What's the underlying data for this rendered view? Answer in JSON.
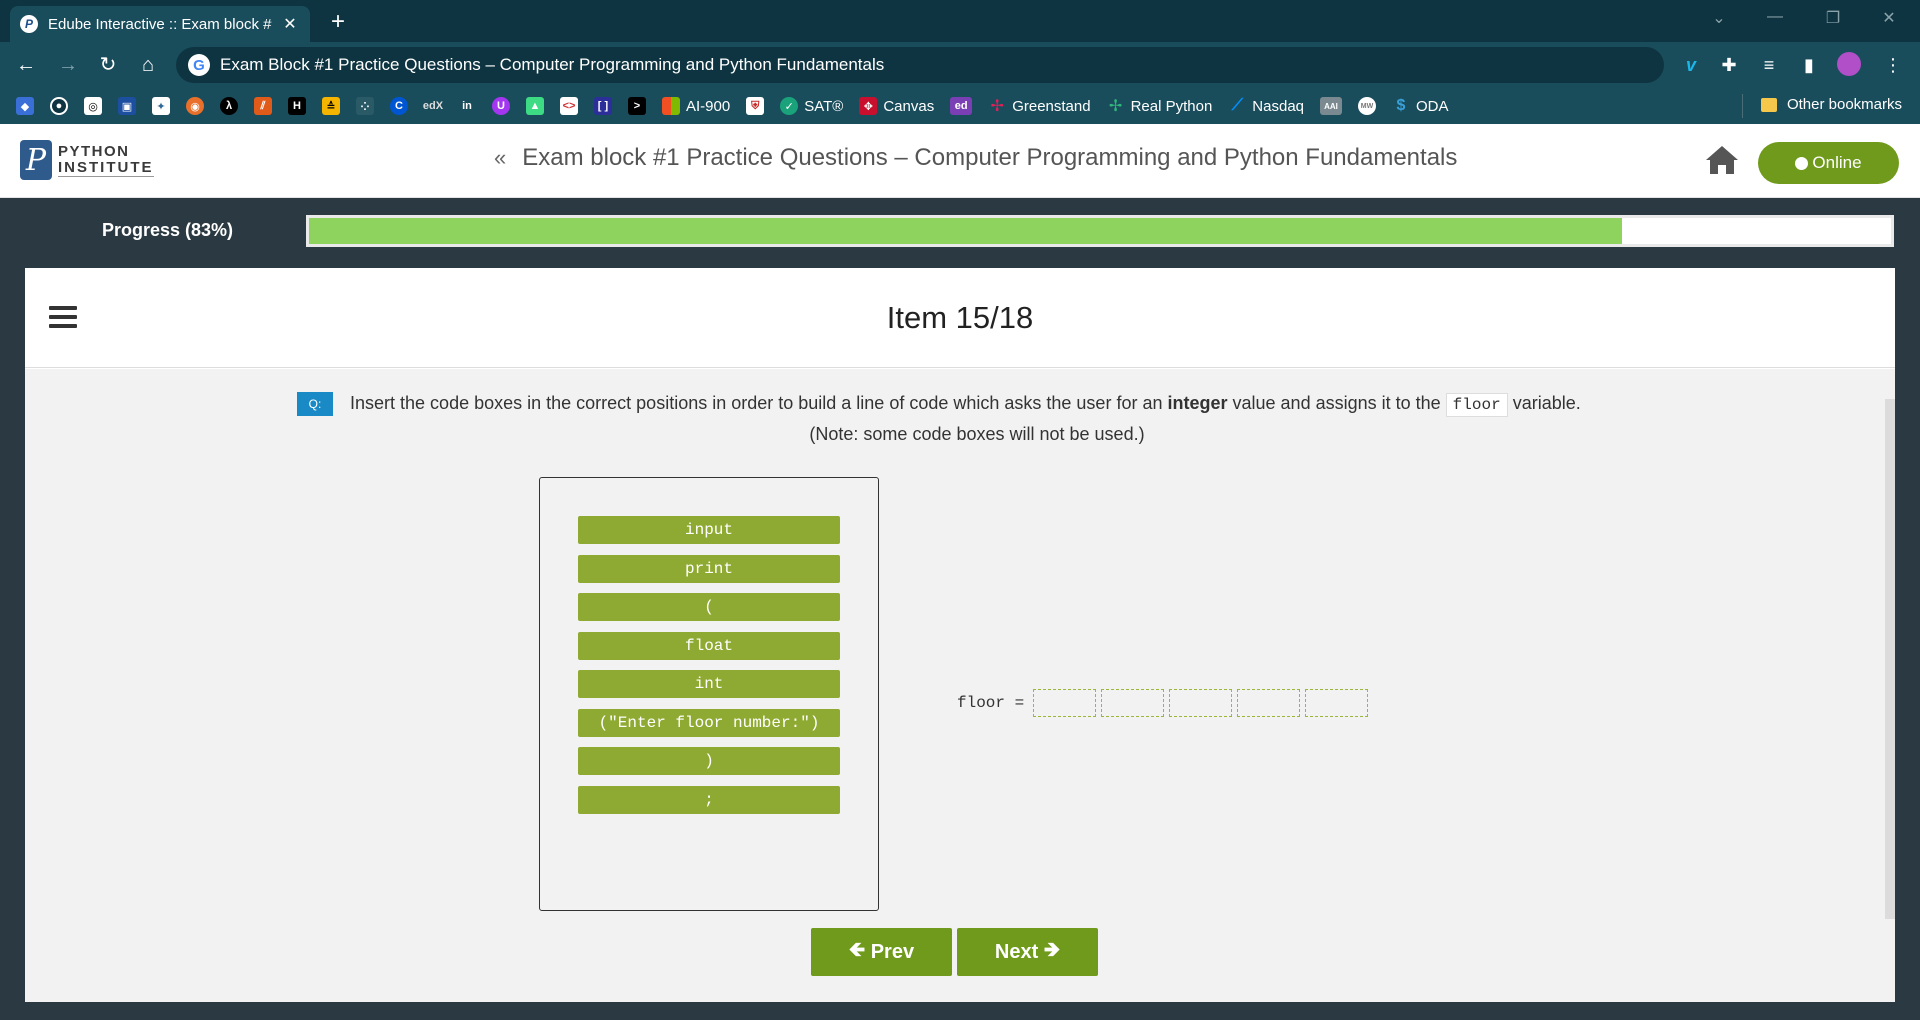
{
  "browser": {
    "tab_title": "Edube Interactive :: Exam block #",
    "tab_close": "✕",
    "new_tab": "+",
    "url": "Exam Block #1 Practice Questions – Computer Programming and Python Fundamentals",
    "bookmarks": [
      {
        "label": "AI-900",
        "icon": "windows-icon",
        "color": "#f25022"
      },
      {
        "label": "SAT®",
        "icon": "sat-icon",
        "color": "#1aa37a"
      },
      {
        "label": "Canvas",
        "icon": "canvas-icon",
        "color": "#c8102e"
      },
      {
        "label": "",
        "icon": "ed-icon",
        "color": "#7b3fb5",
        "text": "ed"
      },
      {
        "label": "Greenstand",
        "icon": "slack-icon",
        "color": "#e01e5a"
      },
      {
        "label": "Real Python",
        "icon": "slack-icon",
        "color": "#2eb67d"
      },
      {
        "label": "Nasdaq",
        "icon": "nasdaq-icon",
        "color": "#0090ff"
      },
      {
        "label": "",
        "icon": "aai-icon",
        "color": "#7a8a90",
        "text": "AAI"
      },
      {
        "label": "",
        "icon": "mw-icon",
        "color": "#9a9a9a",
        "text": "MW"
      },
      {
        "label": "ODA",
        "icon": "oda-icon",
        "color": "#3aa0d8"
      }
    ],
    "other_bookmarks": "Other bookmarks"
  },
  "header": {
    "logo_line1": "PYTHON",
    "logo_line2": "INSTITUTE",
    "back_symbol": "«",
    "title": "Exam block #1 Practice Questions – Computer Programming and Python Fundamentals",
    "online_label": "Online"
  },
  "progress": {
    "label": "Progress (83%)",
    "fraction": 0.83
  },
  "item": {
    "title": "Item 15/18"
  },
  "question": {
    "badge": "Q:",
    "text_before": "Insert the code boxes in the correct positions in order to build a line of code which asks the user for an",
    "bold_word": "integer",
    "text_middle": "value and assigns it to the",
    "code_word": "floor",
    "text_after": "variable.",
    "note": "(Note: some code boxes will not be used.)"
  },
  "code_boxes": [
    "input",
    "print",
    "(",
    "float",
    "int",
    "(\"Enter floor number:\")",
    ")",
    ";"
  ],
  "answer": {
    "lhs": "floor =",
    "slot_count": 5
  },
  "nav": {
    "prev_label": "Prev",
    "next_label": "Next"
  },
  "colors": {
    "accent_green": "#6f9a1c",
    "codebox_green": "#8faa32",
    "progress_fill": "#8fd35f",
    "question_badge": "#1a8ac6"
  }
}
